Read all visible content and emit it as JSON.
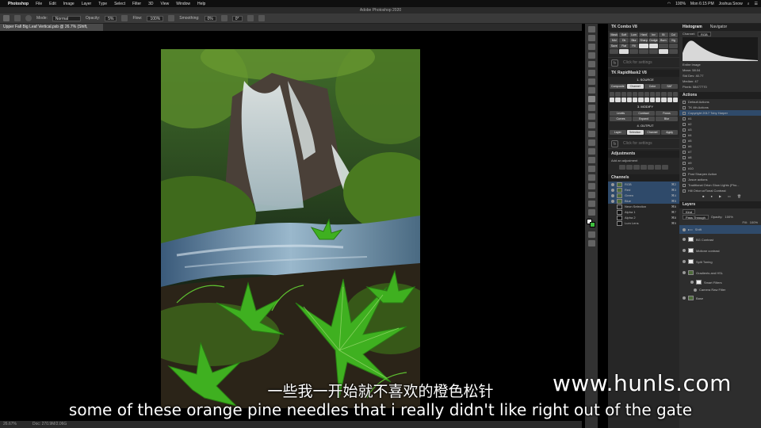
{
  "menubar": {
    "app": "Photoshop",
    "items": [
      "File",
      "Edit",
      "Image",
      "Layer",
      "Type",
      "Select",
      "Filter",
      "3D",
      "View",
      "Window",
      "Help"
    ],
    "battery": "100%",
    "clock": "Mon 6:15 PM",
    "user": "Joshua Snow"
  },
  "titlebar": {
    "title": "Adobe Photoshop 2020"
  },
  "optionsbar": {
    "mode_label": "Mode:",
    "mode_value": "Normal",
    "opacity_label": "Opacity:",
    "opacity_value": "5%",
    "flow_label": "Flow:",
    "flow_value": "100%",
    "smoothing_label": "Smoothing:",
    "smoothing_value": "0%",
    "angle_value": "0°"
  },
  "document": {
    "tab_label": "Upper Fall Big Leaf Vertical.psb @ 26.7% (Shift, RGB/16*) *",
    "zoom": "26.67%",
    "doc_info": "Doc: 270.9M/2.06G"
  },
  "tk_combo": {
    "title": "TK Combo V8",
    "buttons": [
      "Mask",
      "Soft",
      "Lum",
      "Hard",
      "Inv",
      "Bl",
      "Col",
      "Mid",
      "Dk",
      "Blur",
      "Sharp",
      "Dodge",
      "Burn",
      "Vig",
      "Save",
      "Flat",
      "Fill"
    ],
    "settings_label": "Click for settings"
  },
  "tk_rapidmask": {
    "title": "TK RapidMask2 V8",
    "source_label": "1. SOURCE",
    "tabs": [
      "Composite",
      "Channel",
      "Color",
      "SAT"
    ],
    "modify_label": "3. MODIFY",
    "modify_buttons": [
      "Levels",
      "Contract",
      "Focus",
      "Curves",
      "Expand",
      "Blur"
    ],
    "output_label": "4. OUTPUT",
    "output_buttons": [
      "Layer",
      "Selection",
      "Channel",
      "Apply"
    ],
    "settings_label": "Click for settings"
  },
  "adjustments": {
    "title": "Adjustments",
    "hint": "Add an adjustment"
  },
  "channels": {
    "title": "Channels",
    "rows": [
      {
        "name": "RGB",
        "key": "⌘2"
      },
      {
        "name": "Red",
        "key": "⌘3"
      },
      {
        "name": "Green",
        "key": "⌘4"
      },
      {
        "name": "Blue",
        "key": "⌘5"
      },
      {
        "name": "Neon Selection",
        "key": "⌘6"
      },
      {
        "name": "Alpha 1",
        "key": "⌘7"
      },
      {
        "name": "Alpha 2",
        "key": "⌘8"
      },
      {
        "name": "Lum Lens",
        "key": "⌘9"
      }
    ]
  },
  "histogram": {
    "tabs": [
      "Histogram",
      "Navigator"
    ],
    "channel_label": "Channel:",
    "channel_value": "RGB",
    "source_label": "Entire Image",
    "stats": [
      "Mean: 58.04",
      "Std Dev: 40.77",
      "Median: 47",
      "Pixels: 58477770"
    ]
  },
  "actions": {
    "title": "Actions",
    "rows": [
      "Default Actions",
      "TK 4th Actions",
      "Copyright 2017 Toby Harper",
      "#1",
      "#2",
      "#3",
      "#4",
      "#5",
      "#6",
      "#7",
      "#8",
      "#9",
      "#10",
      "Post Sharpen Action",
      "Josue actions",
      "Traditional Orton Glow Lights (Pho...",
      "Hill Orton w/Tonal Contrast"
    ]
  },
  "layers": {
    "title": "Layers",
    "filter_label": "Kind",
    "blend_value": "Pass Through",
    "opacity_label": "Opacity:",
    "opacity_value": "100%",
    "fill_label": "Fill:",
    "fill_value": "100%",
    "rows": [
      {
        "name": "Shift",
        "type": "group"
      },
      {
        "name": "BG Contrast",
        "type": "mask"
      },
      {
        "name": "Midtone contrast",
        "type": "mask"
      },
      {
        "name": "Split Toning",
        "type": "mask"
      },
      {
        "name": "Gradients and HSL",
        "type": "photo"
      },
      {
        "name": "Smart Filters",
        "type": "filter"
      },
      {
        "name": "Camera Raw Filter",
        "type": "filter"
      },
      {
        "name": "Base",
        "type": "photo"
      }
    ]
  },
  "subtitles": {
    "cn": "一些我一开始就不喜欢的橙色松针",
    "en": "some of these orange pine needles that i really didn't like right out of the gate"
  },
  "watermark": "www.hunls.com"
}
